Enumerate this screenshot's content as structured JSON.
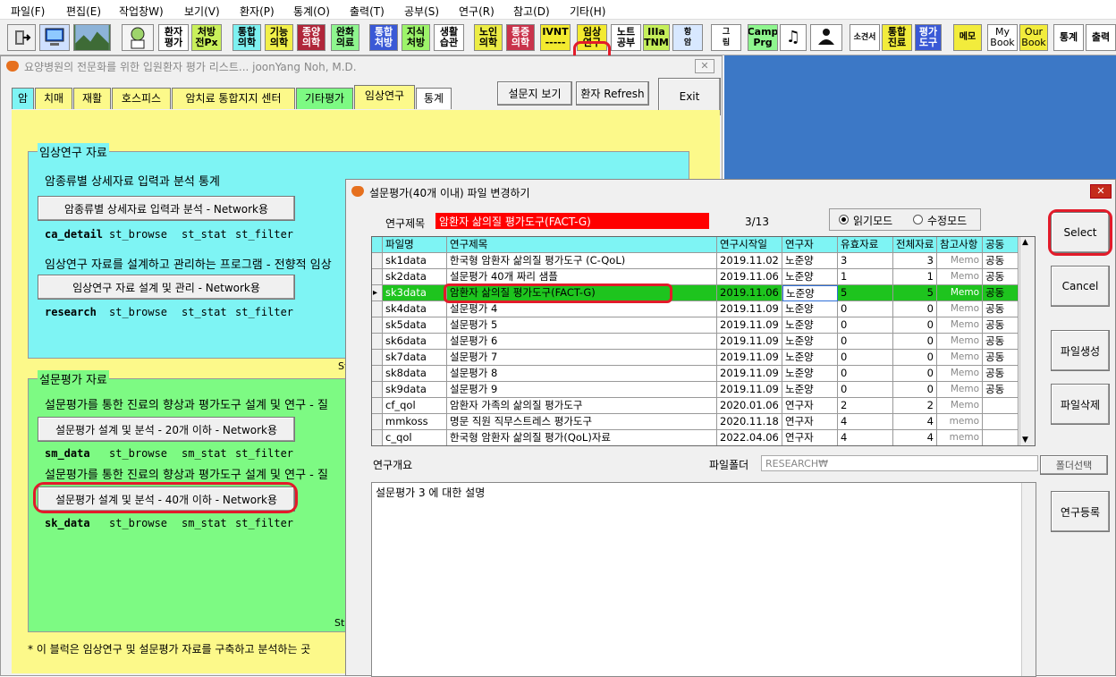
{
  "menu": [
    "파일(F)",
    "편집(E)",
    "작업창W)",
    "보기(V)",
    "환자(P)",
    "통계(O)",
    "출력(T)",
    "공부(S)",
    "연구(R)",
    "참고(D)",
    "기타(H)"
  ],
  "toolbar": {
    "b1": [
      "환자",
      "평가"
    ],
    "b2": [
      "처방",
      "전Px"
    ],
    "b3": [
      "통합",
      "의학"
    ],
    "b4": [
      "기능",
      "의학"
    ],
    "b5": [
      "종양",
      "의학"
    ],
    "b6": [
      "완화",
      "의료"
    ],
    "b7": [
      "통합",
      "처방"
    ],
    "b8": [
      "지식",
      "처방"
    ],
    "b9": [
      "생활",
      "습관"
    ],
    "b10": [
      "노인",
      "의학"
    ],
    "b11": [
      "통증",
      "의학"
    ],
    "b12": [
      "IVNT",
      "-----"
    ],
    "b13": [
      "임상",
      "연구"
    ],
    "b14": [
      "노트",
      "공부"
    ],
    "b15": [
      "IIIa",
      "TNM"
    ],
    "b16": [
      "항",
      "암"
    ],
    "b17": [
      "그",
      "림"
    ],
    "b18": [
      "Camp",
      "Prg"
    ],
    "b19": [
      "소견서"
    ],
    "b20": [
      "통합",
      "진료"
    ],
    "b21": [
      "평가",
      "도구"
    ],
    "b22": [
      "메모"
    ],
    "b23": [
      "My",
      "Book"
    ],
    "b24": [
      "Our",
      "Book"
    ],
    "b25": [
      "통계"
    ],
    "b26": [
      "출력"
    ]
  },
  "colors": {
    "accent_red": "#e21b2a",
    "cyan": "#7ef4f4",
    "yellow": "#fcf98a",
    "green": "#7dfa83",
    "selected_row": "#1ec41e",
    "desktop": "#3c78c6"
  },
  "main": {
    "title": "요양병원의 전문화를 위한 입원환자 평가 리스트... joonYang Noh, M.D.",
    "tabs": [
      "암",
      "치매",
      "재활",
      "호스피스",
      "암치료 통합지지 센터",
      "기타평가",
      "임상연구",
      "통계"
    ],
    "btn_survey_view": "설문지 보기",
    "btn_refresh": "환자 Refresh",
    "btn_exit": "Exit",
    "clinical": {
      "label": "임상연구 자료",
      "line1": "암종류별 상세자료 입력과 분석 통계",
      "btn1": "암종류별 상세자료 입력과 분석 - Network용",
      "row1": [
        "ca_detail",
        "st_browse",
        "st_stat",
        "st_filter"
      ],
      "line2": "임상연구 자료를 설계하고 관리하는 프로그램 - 전향적 임상",
      "btn2": "임상연구 자료 설계 및 관리 - Network용",
      "row2": [
        "research",
        "st_browse",
        "st_stat",
        "st_filter"
      ],
      "cut": "St"
    },
    "survey": {
      "label": "설문평가 자료",
      "line1": "설문평가를 통한 진료의 향상과 평가도구 설계 및 연구 - 질",
      "btn1": "설문평가 설계 및 분석 - 20개 이하 - Network용",
      "row1": [
        "sm_data",
        "st_browse",
        "sm_stat",
        "st_filter"
      ],
      "line2": "설문평가를 통한 진료의 향상과 평가도구 설계 및 연구 - 질",
      "btn2": "설문평가 설계 및 분석 - 40개 이하 - Network용",
      "row2": [
        "sk_data",
        "st_browse",
        "sm_stat",
        "st_filter"
      ],
      "cut": "St"
    },
    "footer": "* 이 블럭은 임상연구 및 설문평가 자료를 구축하고 분석하는 곳"
  },
  "dialog": {
    "title": "설문평가(40개 이내) 파일 변경하기",
    "study_label": "연구제목",
    "study_value": "암환자 삶의질 평가도구(FACT-G)",
    "counter": "3/13",
    "mode_read": "읽기모드",
    "mode_edit": "수정모드",
    "headers": [
      "파일명",
      "연구제목",
      "연구시작일",
      "연구자",
      "유효자료",
      "전체자료",
      "참고사항",
      "공동"
    ],
    "rows": [
      [
        "sk1data",
        "한국형 암환자 삶의질 평가도구 (C-QoL)",
        "2019.11.02",
        "노준양",
        "3",
        "3",
        "Memo",
        "공동"
      ],
      [
        "sk2data",
        "설문평가 40개 짜리 샘플",
        "2019.11.06",
        "노준양",
        "1",
        "1",
        "Memo",
        "공동"
      ],
      [
        "sk3data",
        "암환자 삶의질 평가도구(FACT-G)",
        "2019.11.06",
        "노준양",
        "5",
        "5",
        "Memo",
        "공동"
      ],
      [
        "sk4data",
        "설문평가 4",
        "2019.11.09",
        "노준양",
        "0",
        "0",
        "Memo",
        "공동"
      ],
      [
        "sk5data",
        "설문평가 5",
        "2019.11.09",
        "노준양",
        "0",
        "0",
        "Memo",
        "공동"
      ],
      [
        "sk6data",
        "설문평가 6",
        "2019.11.09",
        "노준양",
        "0",
        "0",
        "Memo",
        "공동"
      ],
      [
        "sk7data",
        "설문평가 7",
        "2019.11.09",
        "노준양",
        "0",
        "0",
        "Memo",
        "공동"
      ],
      [
        "sk8data",
        "설문평가 8",
        "2019.11.09",
        "노준양",
        "0",
        "0",
        "Memo",
        "공동"
      ],
      [
        "sk9data",
        "설문평가 9",
        "2019.11.09",
        "노준양",
        "0",
        "0",
        "Memo",
        "공동"
      ],
      [
        "cf_qol",
        "암환자 가족의 삶의질 평가도구",
        "2020.01.06",
        "연구자",
        "2",
        "2",
        "Memo",
        ""
      ],
      [
        "mmkoss",
        "명문 직원 직무스트레스 평가도구",
        "2020.11.18",
        "연구자",
        "4",
        "4",
        "memo",
        ""
      ],
      [
        "c_qol",
        "한국형 암환자 삶의질 평가(QoL)자료",
        "2022.04.06",
        "연구자",
        "4",
        "4",
        "memo",
        ""
      ]
    ],
    "overview_label": "연구개요",
    "folder_label": "파일폴더",
    "folder_value": "RESEARCH₩",
    "btn_folder": "폴더선택",
    "description": "설문평가 3 에 대한 설명",
    "btn_select": "Select",
    "btn_cancel": "Cancel",
    "btn_create": "파일생성",
    "btn_delete": "파일삭제",
    "btn_register": "연구등록"
  }
}
